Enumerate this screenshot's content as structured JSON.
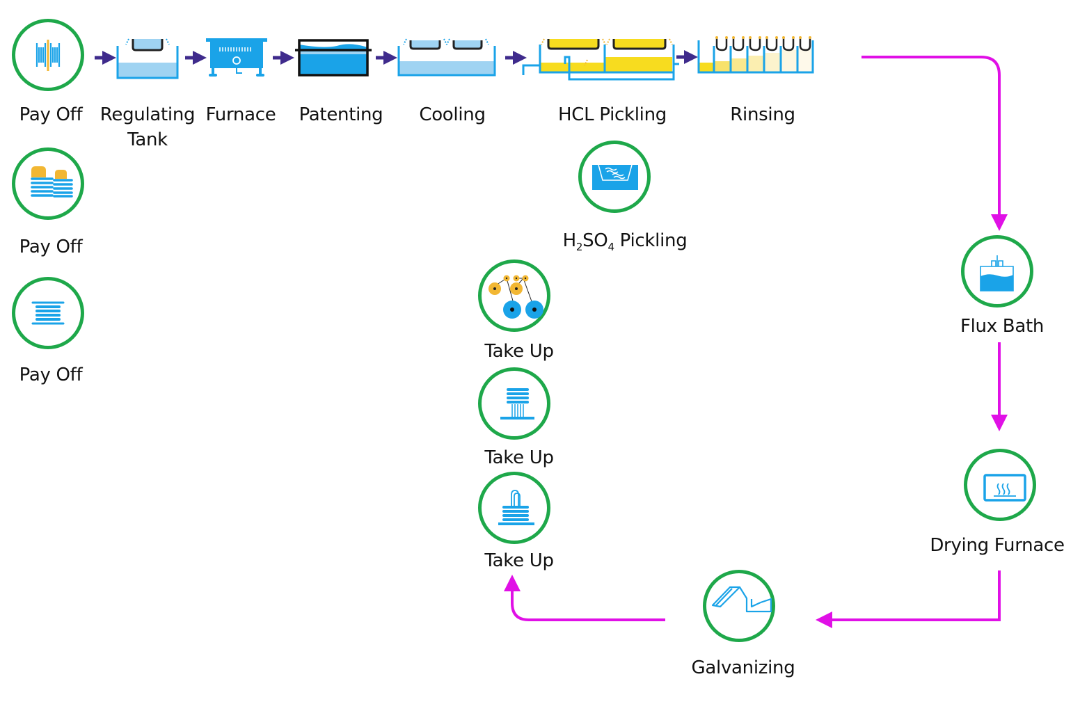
{
  "colors": {
    "node_ring": "#1ea84a",
    "process_blue": "#1aa3e8",
    "light_blue": "#9fd3f2",
    "acid_yellow": "#f7dc1f",
    "spool_orange": "#f2b733",
    "small_arrow": "#3f2b8c",
    "flow_arrow": "#e010e6"
  },
  "top_line": {
    "steps": [
      {
        "id": "pay-off-1",
        "label": "Pay Off",
        "icon": "spool-reel-icon"
      },
      {
        "id": "regulating-tank",
        "label_line1": "Regulating",
        "label_line2": "Tank",
        "icon": "regulating-tank-icon"
      },
      {
        "id": "furnace",
        "label": "Furnace",
        "icon": "furnace-icon"
      },
      {
        "id": "patenting",
        "label": "Patenting",
        "icon": "patenting-bath-icon"
      },
      {
        "id": "cooling",
        "label": "Cooling",
        "icon": "cooling-tank-icon"
      },
      {
        "id": "hcl-pickling",
        "label": "HCL Pickling",
        "icon": "hcl-pickling-tank-icon"
      },
      {
        "id": "rinsing",
        "label": "Rinsing",
        "icon": "rinsing-cascade-icon"
      }
    ]
  },
  "pay_off_alternatives": [
    {
      "label": "Pay Off",
      "icon": "coil-stack-icon"
    },
    {
      "label": "Pay Off",
      "icon": "spool-flat-icon"
    }
  ],
  "h2so4": {
    "prefix": "H",
    "sub1": "2",
    "mid": "SO",
    "sub2": "4",
    "suffix": " Pickling",
    "icon": "acid-bath-icon"
  },
  "flux_bath": {
    "label": "Flux Bath",
    "icon": "flux-bath-icon"
  },
  "drying_furnace": {
    "label": "Drying Furnace",
    "icon": "drying-oven-icon"
  },
  "galvanizing": {
    "label": "Galvanizing",
    "icon": "galvanizing-kettle-icon"
  },
  "take_up": [
    {
      "label": "Take Up",
      "icon": "capstan-take-up-icon"
    },
    {
      "label": "Take Up",
      "icon": "coil-take-up-icon"
    },
    {
      "label": "Take Up",
      "icon": "stand-take-up-icon"
    }
  ]
}
